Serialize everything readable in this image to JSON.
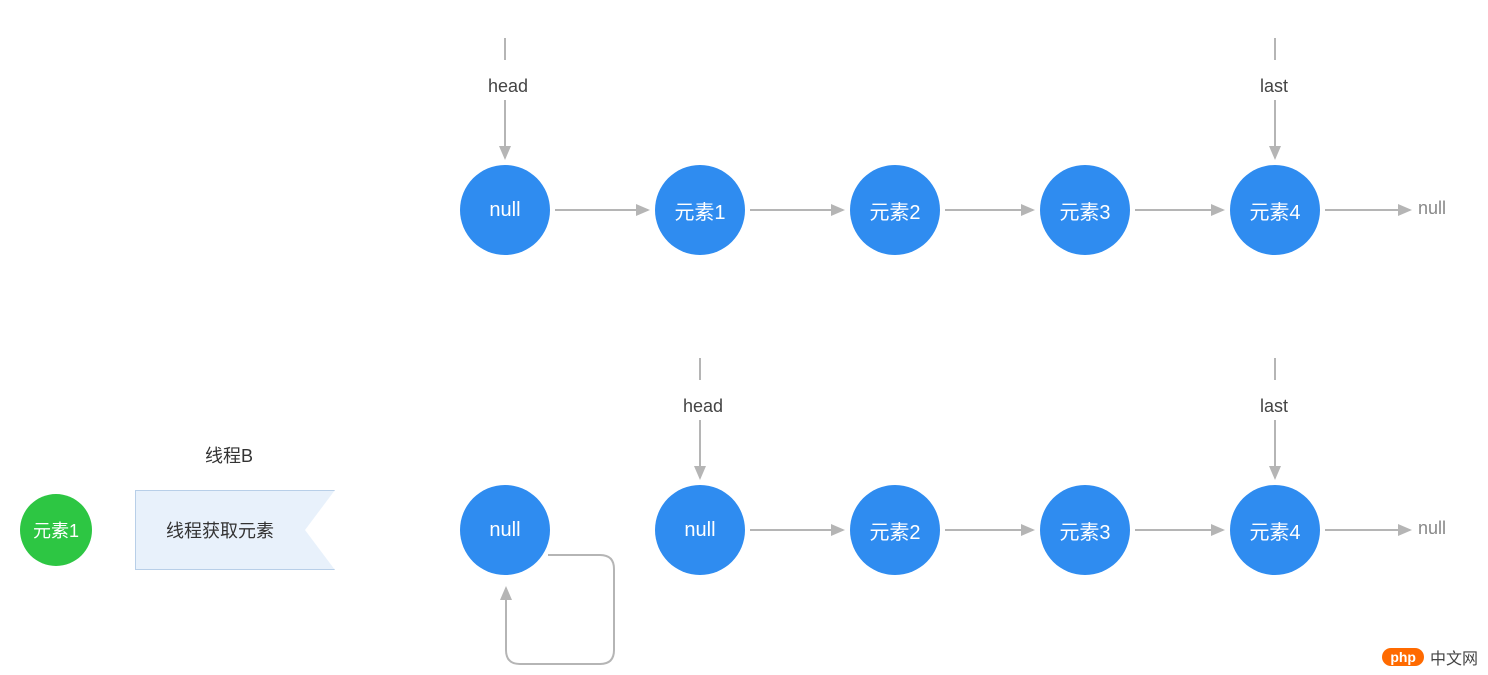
{
  "chart_data": {
    "type": "diagram",
    "title": "",
    "rows": [
      {
        "head_label": "head",
        "last_label": "last",
        "nodes": [
          "null",
          "元素1",
          "元素2",
          "元素3",
          "元素4"
        ],
        "head_index": 0,
        "last_index": 4,
        "after_last": "null",
        "self_loop_on_head": false
      },
      {
        "head_label": "head",
        "last_label": "last",
        "nodes": [
          "null",
          "null",
          "元素2",
          "元素3",
          "元素4"
        ],
        "head_index": 1,
        "last_index": 4,
        "after_last": "null",
        "self_loop_on_head": true,
        "self_loop_index": 0
      }
    ],
    "thread": {
      "label": "线程B",
      "action": "线程获取元素",
      "result_element": "元素1"
    }
  },
  "watermark": {
    "brand": "php",
    "site": "中文网"
  }
}
